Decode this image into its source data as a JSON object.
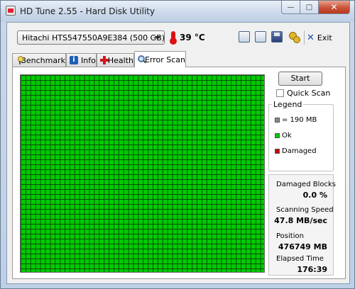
{
  "window": {
    "title": "HD Tune 2.55 - Hard Disk Utility",
    "controls": {
      "minimize": "—",
      "maximize": "□",
      "close": "✕"
    }
  },
  "toolbar": {
    "drive": "Hitachi HTS547550A9E384 (500 GB)",
    "temperature": "39 °C",
    "exit_label": "Exit"
  },
  "tabs": [
    {
      "label": "Benchmark",
      "icon": "benchmark-icon",
      "active": false
    },
    {
      "label": "Info",
      "icon": "info-icon",
      "active": false
    },
    {
      "label": "Health",
      "icon": "health-icon",
      "active": false
    },
    {
      "label": "Error Scan",
      "icon": "error-scan-icon",
      "active": true
    }
  ],
  "error_scan": {
    "start_label": "Start",
    "quick_scan_label": "Quick Scan",
    "quick_scan_checked": false,
    "legend": {
      "title": "Legend",
      "items": [
        {
          "label": "= 190 MB",
          "color": "#8a8a8a"
        },
        {
          "label": "Ok",
          "color": "#00cc00"
        },
        {
          "label": "Damaged",
          "color": "#cc0000"
        }
      ]
    },
    "stats": {
      "damaged_blocks_label": "Damaged Blocks",
      "damaged_blocks_value": "0.0 %",
      "scanning_speed_label": "Scanning Speed",
      "scanning_speed_value": "47.8 MB/sec",
      "position_label": "Position",
      "position_value": "476749 MB",
      "elapsed_time_label": "Elapsed Time",
      "elapsed_time_value": "176:39"
    },
    "grid_color_ok": "#00cc00"
  }
}
